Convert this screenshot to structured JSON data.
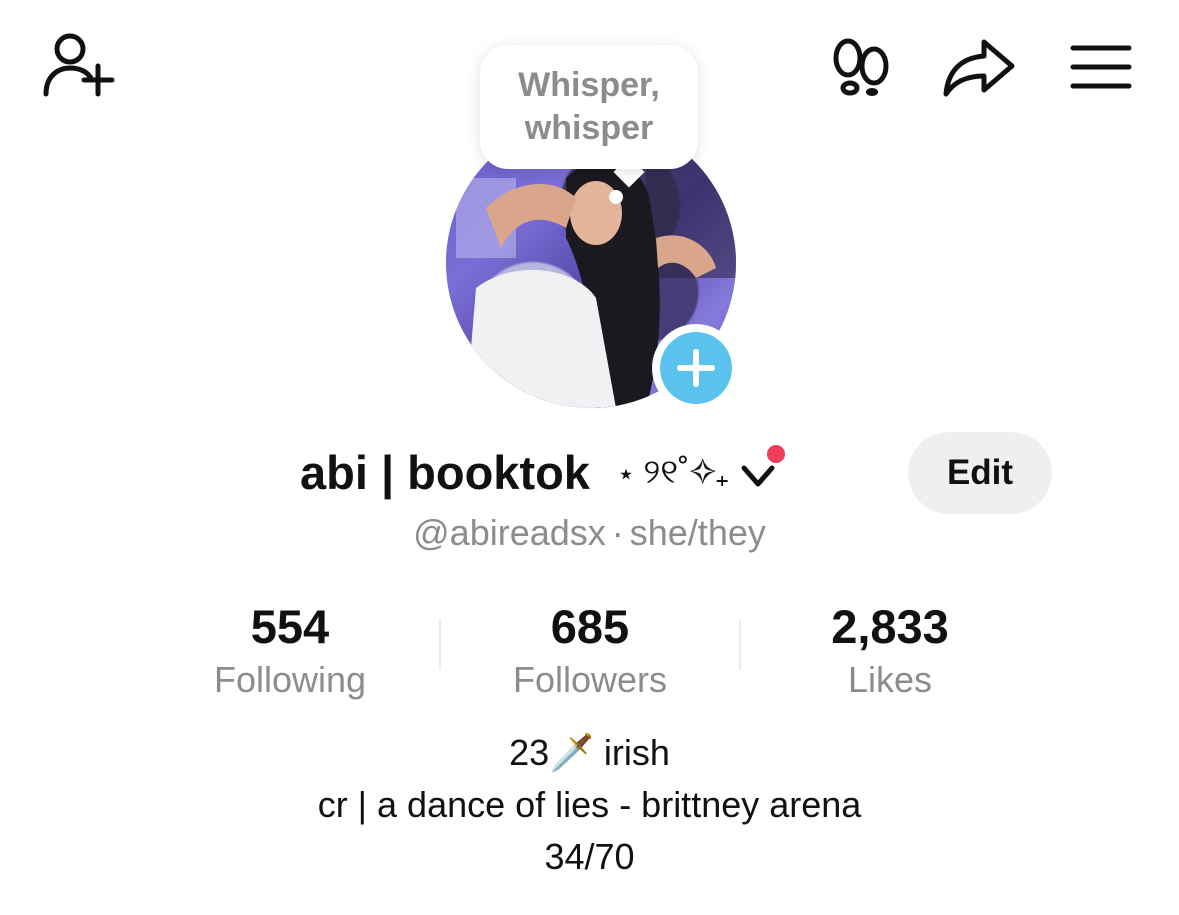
{
  "header": {
    "add_friend_icon": "person-plus-icon",
    "footprints_icon": "footprints-icon",
    "share_icon": "share-arrow-icon",
    "menu_icon": "hamburger-menu-icon"
  },
  "bubble": {
    "line1": "Whisper,",
    "line2": "whisper"
  },
  "profile": {
    "display_name": "abi | booktok",
    "name_decoration": "⋆ ୨୧˚✧₊",
    "handle": "@abireadsx",
    "separator": "·",
    "pronouns": "she/they",
    "edit_label": "Edit",
    "accent_color": "#5cc3ee",
    "notification_color": "#f23d5c"
  },
  "stats": [
    {
      "value": "554",
      "label": "Following"
    },
    {
      "value": "685",
      "label": "Followers"
    },
    {
      "value": "2,833",
      "label": "Likes"
    }
  ],
  "bio": {
    "line1": "23🗡️ irish",
    "line2": "cr | a dance of lies - brittney arena",
    "line3": "34/70"
  }
}
